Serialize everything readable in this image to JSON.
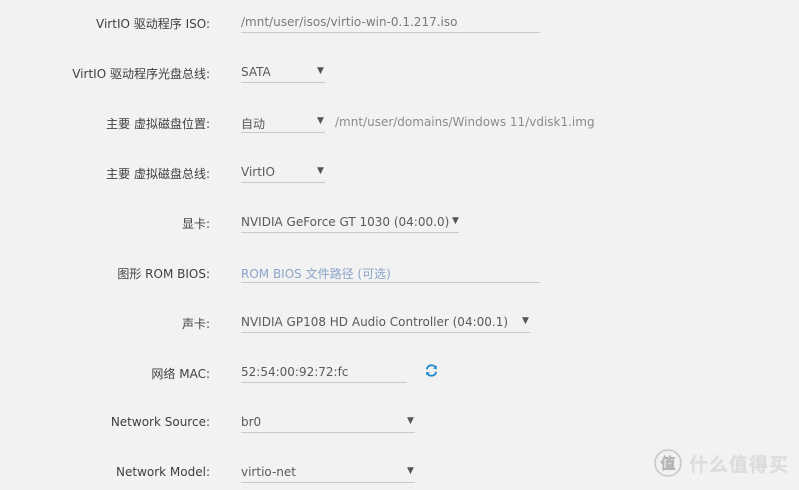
{
  "rows": [
    {
      "label": "VirtIO 驱动程序 ISO:",
      "value": "/mnt/user/isos/virtio-win-0.1.217.iso"
    },
    {
      "label": "VirtIO 驱动程序光盘总线:",
      "value": "SATA"
    },
    {
      "label": "主要 虚拟磁盘位置:",
      "value": "自动",
      "side": "/mnt/user/domains/Windows 11/vdisk1.img"
    },
    {
      "label": "主要 虚拟磁盘总线:",
      "value": "VirtIO"
    },
    {
      "label": "显卡:",
      "value": "NVIDIA GeForce GT 1030 (04:00.0)"
    },
    {
      "label": "图形 ROM BIOS:",
      "placeholder": "ROM BIOS 文件路径 (可选)"
    },
    {
      "label": "声卡:",
      "value": "NVIDIA GP108 HD Audio Controller (04:00.1)"
    },
    {
      "label": "网络 MAC:",
      "value": "52:54:00:92:72:fc"
    },
    {
      "label": "Network Source:",
      "value": "br0"
    },
    {
      "label": "Network Model:",
      "value": "virtio-net"
    }
  ],
  "icons": {
    "refresh": "refresh-icon",
    "dropdown": "caret-down-icon",
    "watermark": "smzdm-logo-icon"
  },
  "colors": {
    "accent": "#1e88c9",
    "placeholder": "#8aa4c8",
    "background": "#f2f2f2"
  },
  "watermark": {
    "text": "什么值得买"
  }
}
